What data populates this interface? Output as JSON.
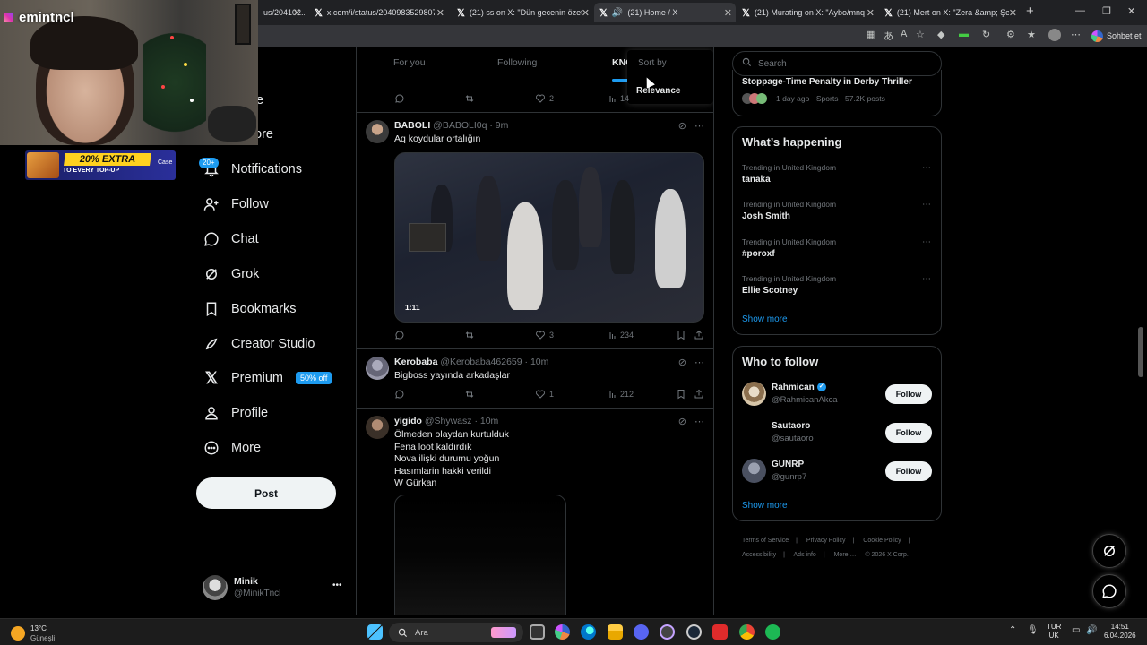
{
  "browser": {
    "tabs": [
      {
        "title": "us/204102...",
        "active": false
      },
      {
        "title": "x.com/i/status/2040983529807288...",
        "active": false
      },
      {
        "title": "(21) ss on X: \"Dün gecenin özeti y...",
        "active": false
      },
      {
        "title": "(21) Home / X",
        "active": true
      },
      {
        "title": "(21) Murating on X: \"Aybo/mnq b...",
        "active": false
      },
      {
        "title": "(21) Mert on X: \"Zera &amp; Şehir...",
        "active": false
      }
    ],
    "new_tab": "+",
    "copilot_label": "Sohbet et"
  },
  "stream_overlay": {
    "channel_name": "emintncl",
    "ad_main": "20% EXTRA",
    "ad_sub": "TO EVERY TOP-UP",
    "ad_brand": "Case"
  },
  "sidebar": {
    "partial_items": [
      "e",
      "ore"
    ],
    "notif_badge": "20+",
    "items": [
      {
        "label": "Notifications",
        "icon": "bell-icon"
      },
      {
        "label": "Follow",
        "icon": "person-plus-icon"
      },
      {
        "label": "Chat",
        "icon": "chat-bubble-icon"
      },
      {
        "label": "Grok",
        "icon": "grok-icon"
      },
      {
        "label": "Bookmarks",
        "icon": "bookmark-icon"
      },
      {
        "label": "Creator Studio",
        "icon": "rocket-icon"
      },
      {
        "label": "Premium",
        "icon": "x-logo-icon",
        "badge": "50% off"
      },
      {
        "label": "Profile",
        "icon": "person-icon"
      },
      {
        "label": "More",
        "icon": "more-circle-icon"
      }
    ],
    "post_button": "Post",
    "account": {
      "name": "Minik",
      "handle": "@MinikTncl",
      "menu": "•••"
    }
  },
  "timeline": {
    "tabs": [
      "For you",
      "Following",
      "KNC"
    ],
    "sort_menu": {
      "header": "Sort by",
      "option": "Relevance"
    },
    "top_actions": {
      "likes": "2",
      "views": "14"
    },
    "tweets": [
      {
        "name": "BABOLI",
        "handle": "@BABOLI0q",
        "time": "9m",
        "text": "Aq koydular ortalığın",
        "media_duration": "1:11",
        "replies": "",
        "retweets": "",
        "likes": "3",
        "views": "234"
      },
      {
        "name": "Kerobaba",
        "handle": "@Kerobaba462659",
        "time": "10m",
        "text": "Bigboss yayında arkadaşlar",
        "replies": "",
        "retweets": "",
        "likes": "1",
        "views": "212"
      },
      {
        "name": "yigido",
        "handle": "@Shywasz",
        "time": "10m",
        "lines": [
          "Ölmeden olaydan kurtulduk",
          "Fena loot kaldırdık",
          "Nova ilişki durumu yoğun",
          "Hasımlarin hakki verildi",
          "W Gürkan"
        ]
      }
    ]
  },
  "right": {
    "search_placeholder": "Search",
    "top_trend": {
      "title": "Stoppage-Time Penalty in Derby Thriller",
      "meta": "1 day ago · Sports · 57.2K posts"
    },
    "whats_happening": {
      "title": "What’s happening",
      "trends": [
        {
          "meta": "Trending in United Kingdom",
          "name": "tanaka"
        },
        {
          "meta": "Trending in United Kingdom",
          "name": "Josh Smith"
        },
        {
          "meta": "Trending in United Kingdom",
          "name": "#poroxf"
        },
        {
          "meta": "Trending in United Kingdom",
          "name": "Ellie Scotney"
        }
      ],
      "show_more": "Show more"
    },
    "who_to_follow": {
      "title": "Who to follow",
      "users": [
        {
          "name": "Rahmican",
          "handle": "@RahmicanAkca",
          "verified": true,
          "button": "Follow"
        },
        {
          "name": "Sautaoro",
          "handle": "@sautaoro",
          "verified": false,
          "button": "Follow"
        },
        {
          "name": "GUNRP",
          "handle": "@gunrp7",
          "verified": false,
          "button": "Follow"
        }
      ],
      "show_more": "Show more"
    },
    "footer": [
      "Terms of Service",
      "|",
      "Privacy Policy",
      "|",
      "Cookie Policy",
      "|",
      "Accessibility",
      "|",
      "Ads info",
      "|",
      "More …",
      "© 2026 X Corp."
    ]
  },
  "taskbar": {
    "weather_temp": "13°C",
    "weather_desc": "Güneşli",
    "search_label": "Ara",
    "lang_1": "TUR",
    "lang_2": "UK",
    "time": "14:51",
    "date": "6.04.2026"
  },
  "colors": {
    "accent": "#1d9bf0",
    "background": "#000000",
    "muted": "#71767b",
    "border": "#2f3336"
  }
}
